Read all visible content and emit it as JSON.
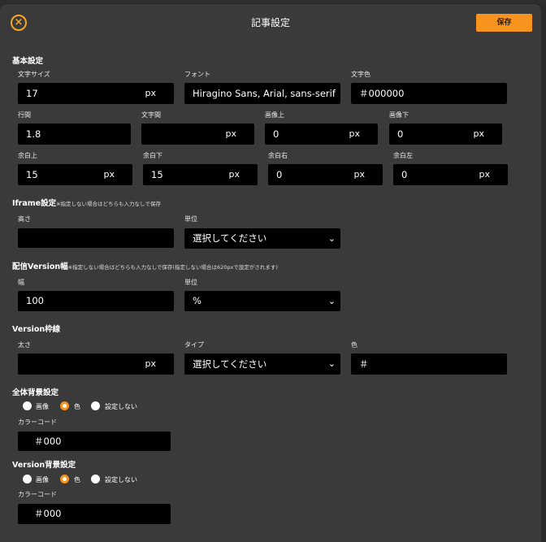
{
  "header": {
    "title": "記事設定",
    "save_label": "保存",
    "close_icon": "close-icon"
  },
  "basic": {
    "title": "基本設定",
    "font_size": {
      "label": "文字サイズ",
      "value": "17",
      "unit": "px"
    },
    "font": {
      "label": "フォント",
      "value": "Hiragino Sans, Arial, sans-serif"
    },
    "text_color": {
      "label": "文字色",
      "value": "＃000000"
    },
    "line_height": {
      "label": "行間",
      "value": "1.8"
    },
    "letter_spacing": {
      "label": "文字間",
      "value": "",
      "unit": "px"
    },
    "img_top": {
      "label": "画像上",
      "value": "0",
      "unit": "px"
    },
    "img_bottom": {
      "label": "画像下",
      "value": "0",
      "unit": "px"
    },
    "margin_top": {
      "label": "余白上",
      "value": "15",
      "unit": "px"
    },
    "margin_bottom": {
      "label": "余白下",
      "value": "15",
      "unit": "px"
    },
    "margin_right": {
      "label": "余白右",
      "value": "0",
      "unit": "px"
    },
    "margin_left": {
      "label": "余白左",
      "value": "0",
      "unit": "px"
    }
  },
  "iframe": {
    "title": "Iframe設定",
    "note": "※指定しない場合はどちらも入力なしで保存",
    "height": {
      "label": "高さ",
      "value": ""
    },
    "unit": {
      "label": "単位",
      "value": "選択してください"
    }
  },
  "version_width": {
    "title": "配信Version幅",
    "note": "※指定しない場合はどちらも入力なしで保存(指定しない場合は620pxで設定がされます)",
    "width": {
      "label": "幅",
      "value": "100"
    },
    "unit": {
      "label": "単位",
      "value": "%"
    }
  },
  "version_border": {
    "title": "Version枠線",
    "thickness": {
      "label": "太さ",
      "value": "",
      "unit": "px"
    },
    "type": {
      "label": "タイプ",
      "value": "選択してください"
    },
    "color": {
      "label": "色",
      "value": "＃"
    }
  },
  "global_bg": {
    "title": "全体背景設定",
    "options": [
      "画像",
      "色",
      "設定しない"
    ],
    "selected": "色",
    "color_label": "カラーコード",
    "color_value": "＃000"
  },
  "version_bg": {
    "title": "Version背景設定",
    "options": [
      "画像",
      "色",
      "設定しない"
    ],
    "selected": "色",
    "color_label": "カラーコード",
    "color_value": "＃000"
  }
}
